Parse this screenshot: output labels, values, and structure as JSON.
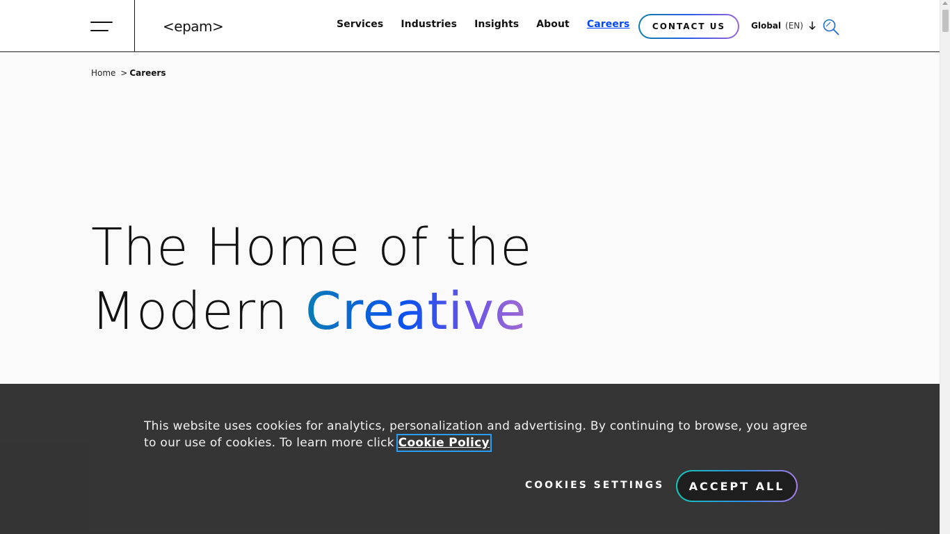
{
  "header": {
    "logo_text": "<epam>",
    "nav": [
      {
        "label": "Services"
      },
      {
        "label": "Industries"
      },
      {
        "label": "Insights"
      },
      {
        "label": "About"
      },
      {
        "label": "Careers",
        "active": true
      }
    ],
    "contact_label": "CONTACT US",
    "language": {
      "region": "Global",
      "code": "(EN)"
    },
    "search_icon": "search-icon",
    "menu_icon": "hamburger-icon"
  },
  "breadcrumb": {
    "home": "Home",
    "separator": ">",
    "current": "Careers"
  },
  "hero": {
    "line1": "The Home of the",
    "line2_prefix": "Modern ",
    "line2_highlight": "Creative"
  },
  "cookie_banner": {
    "text": "This website uses cookies for analytics, personalization and advertising. By continuing to browse, you agree to our use of cookies. To learn more click ",
    "link_label": "Cookie Policy",
    "settings_label": "COOKIES SETTINGS",
    "accept_label": "ACCEPT ALL"
  },
  "colors": {
    "accent_blue": "#0047ff",
    "banner_bg": "#1e1e1e",
    "gradient_start": "#0b7bb5",
    "gradient_end": "#a06bd4"
  }
}
